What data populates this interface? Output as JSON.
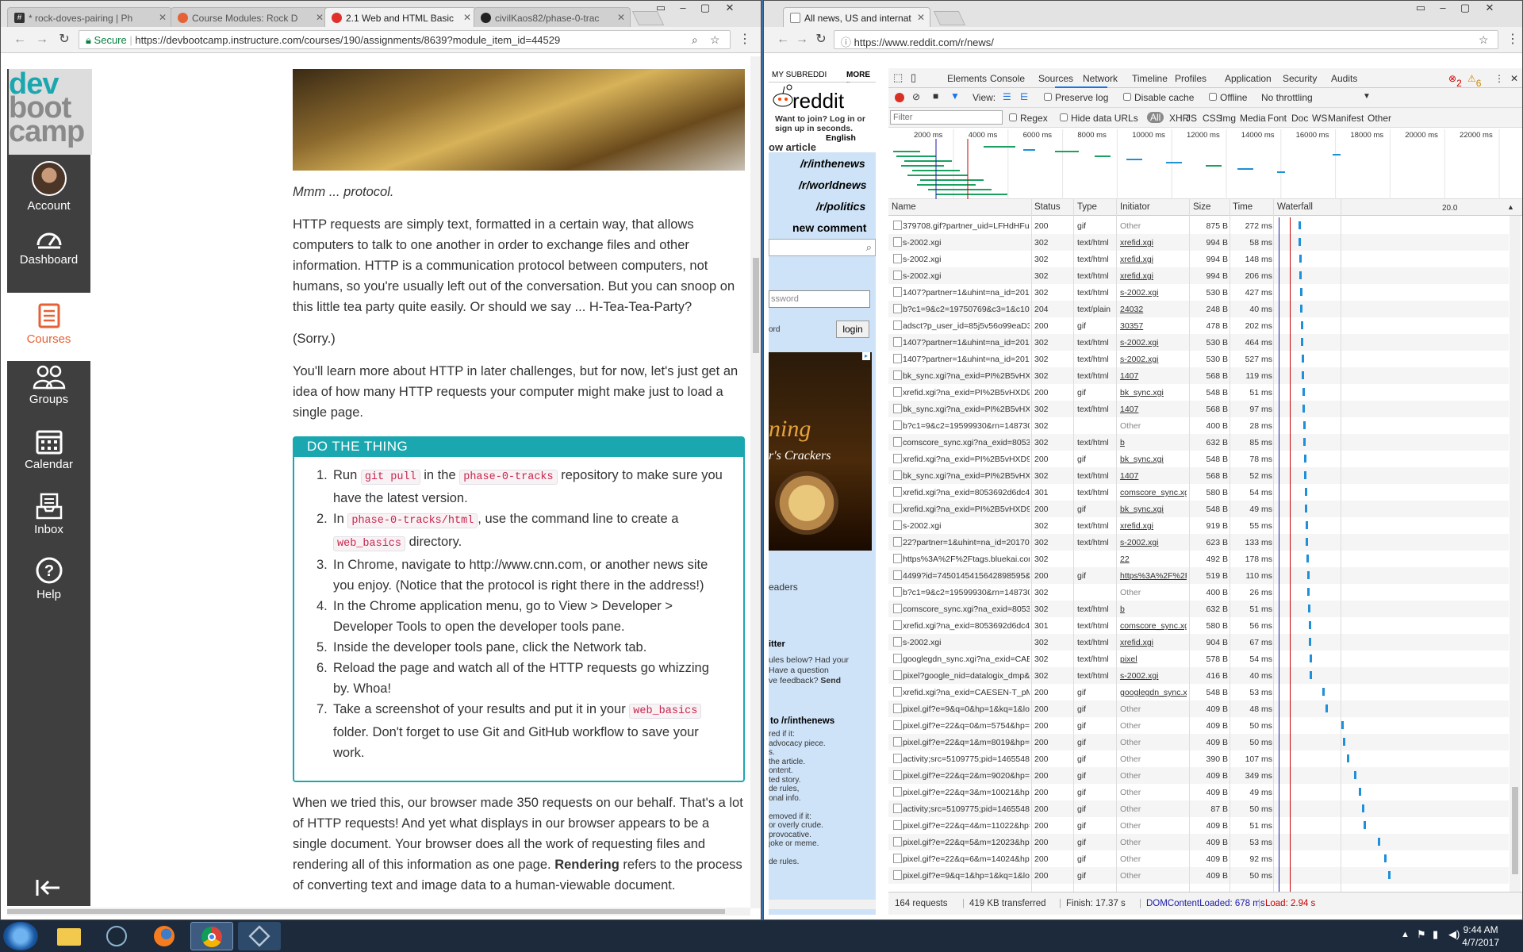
{
  "left_window": {
    "tabs": [
      {
        "label": "* rock-doves-pairing | Ph"
      },
      {
        "label": "Course Modules: Rock D"
      },
      {
        "label": "2.1 Web and HTML Basic"
      },
      {
        "label": "civilKaos82/phase-0-trac"
      }
    ],
    "secure_label": "Secure",
    "url": "https://devbootcamp.instructure.com/courses/190/assignments/8639?module_item_id=44529",
    "logo": [
      "dev",
      "boot",
      "camp"
    ],
    "nav": [
      {
        "label": "Account",
        "icon": "avatar"
      },
      {
        "label": "Dashboard",
        "icon": "dashboard-icon"
      },
      {
        "label": "Courses",
        "icon": "courses-icon"
      },
      {
        "label": "Groups",
        "icon": "groups-icon"
      },
      {
        "label": "Calendar",
        "icon": "calendar-icon"
      },
      {
        "label": "Inbox",
        "icon": "inbox-icon"
      },
      {
        "label": "Help",
        "icon": "help-icon"
      }
    ],
    "collapse_icon": "collapse-nav-icon",
    "article": {
      "caption": "Mmm ... protocol.",
      "p1": "HTTP requests are simply text, formatted in a certain way, that allows computers to talk to one another in order to exchange files and other information. HTTP is a communication protocol between computers, not humans, so you're usually left out of the conversation. But you can snoop on this little tea party quite easily. Or should we say ... H-Tea-Tea-Party?",
      "p2": "(Sorry.)",
      "p3": "You'll learn more about HTTP in later challenges, but for now, let's just get an idea of how many HTTP requests your computer might make just to load a single page.",
      "do_thing_title": "DO THE THING",
      "steps": [
        {
          "n": "1.",
          "a": "Run ",
          "c1": "git pull",
          "b": " in the ",
          "c2": "phase-0-tracks",
          "d": " repository to make sure you have the latest version."
        },
        {
          "n": "2.",
          "a": "In ",
          "c1": "phase-0-tracks/html",
          "b": ", use the command line to create a ",
          "c2": "web_basics",
          "d": " directory."
        },
        {
          "n": "3.",
          "text": "In Chrome, navigate to http://www.cnn.com, or another news site you enjoy. (Notice that the protocol is right there in the address!)"
        },
        {
          "n": "4.",
          "text": "In the Chrome application menu, go to View > Developer > Developer Tools to open the developer tools pane."
        },
        {
          "n": "5.",
          "text": "Inside the developer tools pane, click the Network tab."
        },
        {
          "n": "6.",
          "text": "Reload the page and watch all of the HTTP requests go whizzing by. Whoa!"
        },
        {
          "n": "7.",
          "a": "Take a screenshot of your results and put it in your ",
          "c1": "web_basics",
          "b": " folder. Don't forget to use Git and GitHub workflow to save your work."
        }
      ],
      "p4_a": "When we tried this, our browser made 350 requests on our behalf. That's a lot of HTTP requests! And yet what displays in our browser appears to be a single document. Your browser does all the work of requesting files and rendering all of this information as one page. ",
      "p4_bold": "Rendering",
      "p4_b": " refers to the process of converting text and image data to a human-viewable document."
    }
  },
  "right_window": {
    "tab": {
      "label": "All news, US and internat"
    },
    "url": "https://www.reddit.com/r/news/",
    "reddit": {
      "my_subreddits": "MY SUBREDDI",
      "more": "MORE »",
      "logo_text": "reddit",
      "join": "Want to join? Log in or sign up in seconds.",
      "language": "English",
      "article_fragment": "ow article",
      "links": [
        "/r/inthenews",
        "/r/worldnews",
        "/r/politics",
        "new comment"
      ],
      "password_placeholder": "ssword",
      "remember": "ord",
      "login": "login",
      "ad_text1": "ning",
      "ad_text2": "r's Crackers",
      "readers": "eaders",
      "twitter": "itter",
      "rules_1": "ules below? Had your",
      "rules_2": "Have a question",
      "rules_3": "ve feedback?",
      "send": "Send",
      "submit_to": "to /r/inthenews",
      "lines": [
        "red if it:",
        "advocacy piece.",
        "s.",
        "the article.",
        "ontent.",
        "ted story.",
        "de rules,",
        "onal info.",
        "",
        "emoved if it:",
        "or overly crude.",
        "provocative.",
        "joke or meme.",
        "",
        "de rules."
      ]
    },
    "devtools": {
      "tabs": [
        "Elements",
        "Console",
        "Sources",
        "Network",
        "Timeline",
        "Profiles",
        "Application",
        "Security",
        "Audits"
      ],
      "active_tab": "Network",
      "errors": "2",
      "warnings": "6",
      "view_label": "View:",
      "preserve_log": "Preserve log",
      "disable_cache": "Disable cache",
      "offline": "Offline",
      "throttling": "No throttling",
      "filter_placeholder": "Filter",
      "regex": "Regex",
      "hide_data_urls": "Hide data URLs",
      "types": [
        "All",
        "XHR",
        "JS",
        "CSS",
        "Img",
        "Media",
        "Font",
        "Doc",
        "WS",
        "Manifest",
        "Other"
      ],
      "timeline_ticks": [
        "2000 ms",
        "4000 ms",
        "6000 ms",
        "8000 ms",
        "10000 ms",
        "12000 ms",
        "14000 ms",
        "16000 ms",
        "18000 ms",
        "20000 ms",
        "22000 ms"
      ],
      "columns": [
        "Name",
        "Status",
        "Type",
        "Initiator",
        "Size",
        "Time",
        "Waterfall"
      ],
      "waterfall_scale": "20.0",
      "rows": [
        [
          "379708.gif?partner_uid=LFHdHFu4",
          "200",
          "gif",
          "Other",
          "875 B",
          "272 ms",
          0.102
        ],
        [
          "s-2002.xgi",
          "302",
          "text/html",
          "xrefid.xgi",
          "994 B",
          "58 ms",
          0.104
        ],
        [
          "s-2002.xgi",
          "302",
          "text/html",
          "xrefid.xgi",
          "994 B",
          "148 ms",
          0.106
        ],
        [
          "s-2002.xgi",
          "302",
          "text/html",
          "xrefid.xgi",
          "994 B",
          "206 ms",
          0.108
        ],
        [
          "1407?partner=1&uhint=na_id=201702...",
          "302",
          "text/html",
          "s-2002.xgi",
          "530 B",
          "427 ms",
          0.11
        ],
        [
          "b?c1=9&c2=19750769&c3=1&c10=0...",
          "204",
          "text/plain",
          "24032",
          "248 B",
          "40 ms",
          0.112
        ],
        [
          "adsct?p_user_id=85j5v56o99eaD3JR&...",
          "200",
          "gif",
          "30357",
          "478 B",
          "202 ms",
          0.114
        ],
        [
          "1407?partner=1&uhint=na_id=201702...",
          "302",
          "text/html",
          "s-2002.xgi",
          "530 B",
          "464 ms",
          0.116
        ],
        [
          "1407?partner=1&uhint=na_id=201702...",
          "302",
          "text/html",
          "s-2002.xgi",
          "530 B",
          "527 ms",
          0.118
        ],
        [
          "bk_sync.xgi?na_exid=PI%2B5vHXD99O...",
          "302",
          "text/html",
          "1407",
          "568 B",
          "119 ms",
          0.12
        ],
        [
          "xrefid.xgi?na_exid=PI%2B5vHXD99Oi...",
          "200",
          "gif",
          "bk_sync.xgi",
          "548 B",
          "51 ms",
          0.122
        ],
        [
          "bk_sync.xgi?na_exid=PI%2B5vHXD99O...",
          "302",
          "text/html",
          "1407",
          "568 B",
          "97 ms",
          0.124
        ],
        [
          "b?c1=9&c2=19599930&rn=14873011...",
          "302",
          "",
          "Other",
          "400 B",
          "28 ms",
          0.126
        ],
        [
          "comscore_sync.xgi?na_exid=8053692d...",
          "302",
          "text/html",
          "b",
          "632 B",
          "85 ms",
          0.128
        ],
        [
          "xrefid.xgi?na_exid=PI%2B5vHXD99Oi...",
          "200",
          "gif",
          "bk_sync.xgi",
          "548 B",
          "78 ms",
          0.13
        ],
        [
          "bk_sync.xgi?na_exid=PI%2B5vHXD99O...",
          "302",
          "text/html",
          "1407",
          "568 B",
          "52 ms",
          0.132
        ],
        [
          "xrefid.xgi?na_exid=8053692d6dc470d...",
          "301",
          "text/html",
          "comscore_sync.xgi",
          "580 B",
          "54 ms",
          0.134
        ],
        [
          "xrefid.xgi?na_exid=PI%2B5vHXD99Oi...",
          "200",
          "gif",
          "bk_sync.xgi",
          "548 B",
          "49 ms",
          0.136
        ],
        [
          "s-2002.xgi",
          "302",
          "text/html",
          "xrefid.xgi",
          "919 B",
          "55 ms",
          0.138
        ],
        [
          "22?partner=1&uhint=na_id=20170216...",
          "302",
          "text/html",
          "s-2002.xgi",
          "623 B",
          "133 ms",
          0.14
        ],
        [
          "https%3A%2F%2Ftags.bluekai.com%2...",
          "302",
          "",
          "22",
          "492 B",
          "178 ms",
          0.142
        ],
        [
          "4499?id=7450145415642898595&BK_...",
          "200",
          "gif",
          "https%3A%2F%2Ft...",
          "519 B",
          "110 ms",
          0.146
        ],
        [
          "b?c1=9&c2=19599930&rn=14873011...",
          "302",
          "",
          "Other",
          "400 B",
          "26 ms",
          0.148
        ],
        [
          "comscore_sync.xgi?na_exid=8053692d...",
          "302",
          "text/html",
          "b",
          "632 B",
          "51 ms",
          0.15
        ],
        [
          "xrefid.xgi?na_exid=8053692d6dc470d...",
          "301",
          "text/html",
          "comscore_sync.xgi",
          "580 B",
          "56 ms",
          0.152
        ],
        [
          "s-2002.xgi",
          "302",
          "text/html",
          "xrefid.xgi",
          "904 B",
          "67 ms",
          0.154
        ],
        [
          "googlegdn_sync.xgi?na_exid=CAESEN...",
          "302",
          "text/html",
          "pixel",
          "578 B",
          "54 ms",
          0.156
        ],
        [
          "pixel?google_nid=datalogix_dmp&go...",
          "302",
          "text/html",
          "s-2002.xgi",
          "416 B",
          "40 ms",
          0.158
        ],
        [
          "xrefid.xgi?na_exid=CAESEN-T_pM41sc...",
          "200",
          "gif",
          "googlegdn_sync.xgi",
          "548 B",
          "53 ms",
          0.22
        ],
        [
          "pixel.gif?e=9&q=0&hp=1&kq=1&lo=...",
          "200",
          "gif",
          "Other",
          "409 B",
          "48 ms",
          0.236
        ],
        [
          "pixel.gif?e=22&q=0&m=5754&hp=1...",
          "200",
          "gif",
          "Other",
          "409 B",
          "50 ms",
          0.31
        ],
        [
          "pixel.gif?e=22&q=1&m=8019&hp=1...",
          "200",
          "gif",
          "Other",
          "409 B",
          "50 ms",
          0.32
        ],
        [
          "activity;src=5109775;pid=146554844;a...",
          "200",
          "gif",
          "Other",
          "390 B",
          "107 ms",
          0.34
        ],
        [
          "pixel.gif?e=22&q=2&m=9020&hp=1...",
          "200",
          "gif",
          "Other",
          "409 B",
          "349 ms",
          0.372
        ],
        [
          "pixel.gif?e=22&q=3&m=10021&hp=1...",
          "200",
          "gif",
          "Other",
          "409 B",
          "49 ms",
          0.396
        ],
        [
          "activity;src=5109775;pid=146554844;a...",
          "200",
          "gif",
          "Other",
          "87 B",
          "50 ms",
          0.41
        ],
        [
          "pixel.gif?e=22&q=4&m=11022&hp=1...",
          "200",
          "gif",
          "Other",
          "409 B",
          "51 ms",
          0.42
        ],
        [
          "pixel.gif?e=22&q=5&m=12023&hp=1...",
          "200",
          "gif",
          "Other",
          "409 B",
          "53 ms",
          0.488
        ],
        [
          "pixel.gif?e=22&q=6&m=14024&hp=1...",
          "200",
          "gif",
          "Other",
          "409 B",
          "92 ms",
          0.52
        ],
        [
          "pixel.gif?e=9&q=1&hp=1&kq=1&lo=...",
          "200",
          "gif",
          "Other",
          "409 B",
          "50 ms",
          0.54
        ]
      ],
      "status": {
        "requests": "164 requests",
        "transferred": "419 KB transferred",
        "finish": "Finish: 17.37 s",
        "dcl": "DOMContentLoaded: 678 ms",
        "load": "Load: 2.94 s"
      },
      "colors": {
        "dcl": "#1a1aa6",
        "load": "#c80000",
        "waterfall": "#1e8fd8"
      }
    }
  },
  "taskbar": {
    "time": "9:44 AM",
    "date": "4/7/2017"
  }
}
